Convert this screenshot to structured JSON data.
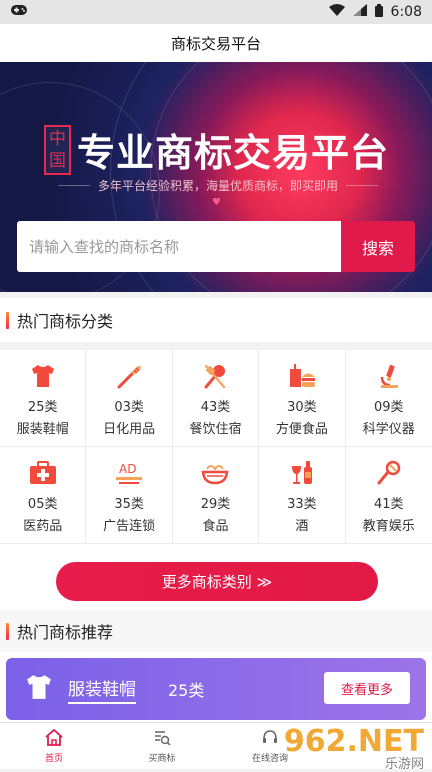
{
  "status": {
    "time": "6:08"
  },
  "header": {
    "title": "商标交易平台"
  },
  "banner": {
    "badge_top": "中",
    "badge_bottom": "国",
    "title": "专业商标交易平台",
    "subtitle": "多年平台经验积累，海量优质商标，即买即用"
  },
  "search": {
    "placeholder": "请输入查找的商标名称",
    "button": "搜索"
  },
  "hot_categories": {
    "title": "热门商标分类",
    "items": [
      {
        "num": "25类",
        "name": "服装鞋帽",
        "icon": "shirt-icon"
      },
      {
        "num": "03类",
        "name": "日化用品",
        "icon": "toothbrush-icon"
      },
      {
        "num": "43类",
        "name": "餐饮住宿",
        "icon": "utensils-icon"
      },
      {
        "num": "30类",
        "name": "方便食品",
        "icon": "fastfood-icon"
      },
      {
        "num": "09类",
        "name": "科学仪器",
        "icon": "microscope-icon"
      },
      {
        "num": "05类",
        "name": "医药品",
        "icon": "medkit-icon"
      },
      {
        "num": "35类",
        "name": "广告连锁",
        "icon": "ad-icon"
      },
      {
        "num": "29类",
        "name": "食品",
        "icon": "bowl-icon"
      },
      {
        "num": "33类",
        "name": "酒",
        "icon": "wine-icon"
      },
      {
        "num": "41类",
        "name": "教育娱乐",
        "icon": "microphone-icon"
      }
    ],
    "more_button": "更多商标类别 ≫"
  },
  "hot_recommend": {
    "title": "热门商标推荐",
    "card": {
      "name": "服装鞋帽",
      "num": "25类",
      "button": "查看更多"
    }
  },
  "tabs": [
    {
      "label": "首页",
      "active": true
    },
    {
      "label": "买商标",
      "active": false
    },
    {
      "label": "在线咨询",
      "active": false
    },
    {
      "label": "",
      "active": false
    }
  ],
  "watermark": {
    "brand": "962.NET",
    "sub": "乐游网"
  },
  "colors": {
    "accent": "#e01a4b",
    "card": "#8b6ae8"
  }
}
